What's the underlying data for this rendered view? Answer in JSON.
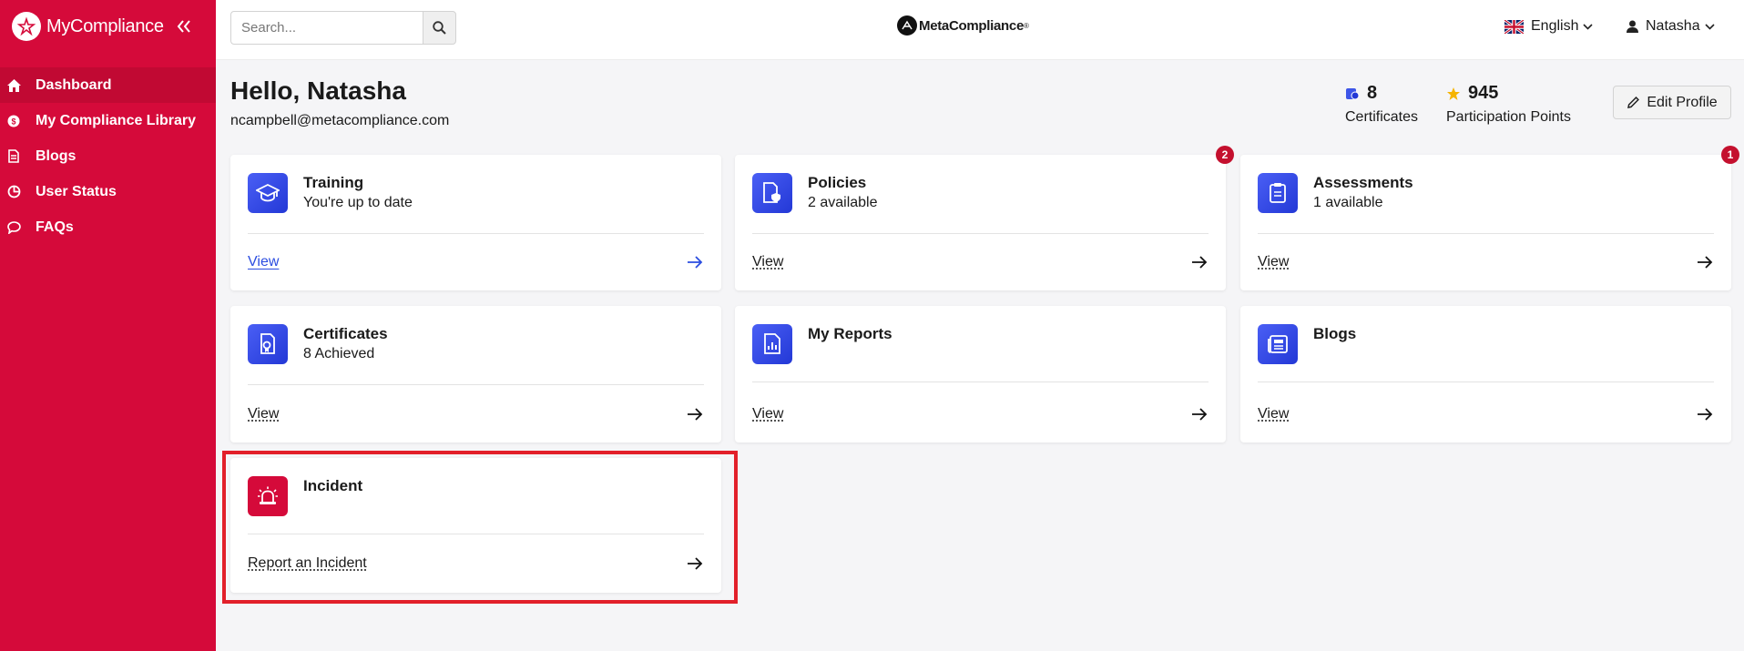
{
  "sidebar": {
    "brand": "MyCompliance",
    "items": [
      {
        "label": "Dashboard",
        "icon": "home-icon"
      },
      {
        "label": "My Compliance Library",
        "icon": "library-icon"
      },
      {
        "label": "Blogs",
        "icon": "document-icon"
      },
      {
        "label": "User Status",
        "icon": "pie-chart-icon"
      },
      {
        "label": "FAQs",
        "icon": "chat-icon"
      }
    ]
  },
  "header": {
    "search_placeholder": "Search...",
    "logo_text": "MetaCompliance",
    "logo_mark": "®",
    "language": "English",
    "user": "Natasha"
  },
  "profile": {
    "greeting": "Hello, Natasha",
    "email": "ncampbell@metacompliance.com",
    "certificates_count": "8",
    "certificates_label": "Certificates",
    "points_count": "945",
    "points_label": "Participation Points",
    "edit_label": "Edit Profile"
  },
  "cards": [
    {
      "title": "Training",
      "subtitle": "You're up to date",
      "link": "View",
      "badge": ""
    },
    {
      "title": "Policies",
      "subtitle": "2 available",
      "link": "View",
      "badge": "2"
    },
    {
      "title": "Assessments",
      "subtitle": "1 available",
      "link": "View",
      "badge": "1"
    },
    {
      "title": "Certificates",
      "subtitle": "8 Achieved",
      "link": "View",
      "badge": ""
    },
    {
      "title": "My Reports",
      "subtitle": "",
      "link": "View",
      "badge": ""
    },
    {
      "title": "Blogs",
      "subtitle": "",
      "link": "View",
      "badge": ""
    },
    {
      "title": "Incident",
      "subtitle": "",
      "link": "Report an Incident",
      "badge": ""
    }
  ],
  "colors": {
    "sidebar": "#d50a3a",
    "accent_blue": "#2b4de0",
    "badge": "#c4102e",
    "highlight": "#e2202a"
  }
}
